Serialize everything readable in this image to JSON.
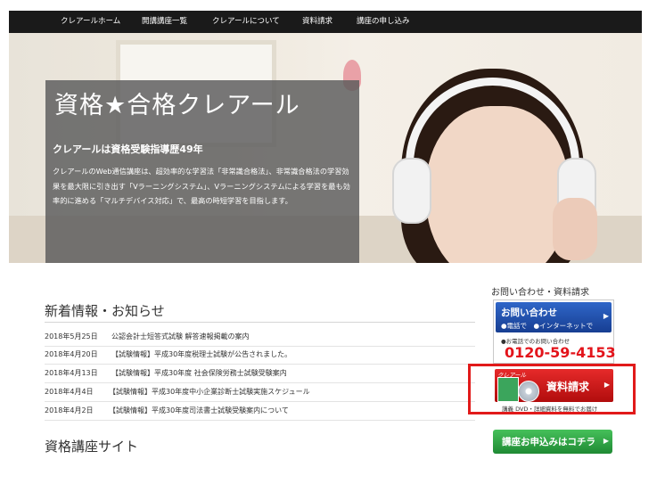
{
  "nav": {
    "items": [
      {
        "label": "クレアールホーム"
      },
      {
        "label": "開講講座一覧"
      },
      {
        "label": "クレアールについて"
      },
      {
        "label": "資料請求"
      },
      {
        "label": "講座の申し込み"
      }
    ]
  },
  "hero": {
    "title": "資格★合格クレアール",
    "subtitle": "クレアールは資格受験指導歴49年",
    "description": "クレアールのWeb通信講座は、超効率的な学習法「非常識合格法」、非常識合格法の学習効果を最大限に引き出す「Vラーニングシステム」、Vラーニングシステムによる学習を最も効率的に進める「マルチデバイス対応」で、最高の時短学習を目指します。"
  },
  "news": {
    "heading": "新着情報・お知らせ",
    "items": [
      {
        "date": "2018年5月25日",
        "text": "公認会計士短答式試験 解答速報掲載の案内"
      },
      {
        "date": "2018年4月20日",
        "text": "【試験情報】平成30年度税理士試験が公告されました。"
      },
      {
        "date": "2018年4月13日",
        "text": "【試験情報】平成30年度 社会保険労務士試験受験案内"
      },
      {
        "date": "2018年4月4日",
        "text": "【試験情報】平成30年度中小企業診断士試験実施スケジュール"
      },
      {
        "date": "2018年4月2日",
        "text": "【試験情報】平成30年度司法書士試験受験案内について"
      }
    ]
  },
  "courses": {
    "heading": "資格講座サイト"
  },
  "sidebar": {
    "heading": "お問い合わせ・資料請求",
    "contact": {
      "title": "お問い合わせ",
      "methods": "●電話で　●インターネットで",
      "phone_note": "●お電話でのお問い合わせ",
      "phone": "0120-59-4153"
    },
    "request": {
      "tag": "クレアール",
      "label": "資料請求",
      "sub": "講義 DVD・詳細資料を無料でお届け"
    },
    "apply": {
      "label": "講座お申込みはコチラ"
    }
  },
  "colors": {
    "nav_bg": "#1a1a1a",
    "contact_blue": "#2f66c8",
    "phone_red": "#e3141b",
    "request_red": "#d41c1c",
    "apply_green": "#2fa345",
    "highlight_border": "#e11a1a"
  },
  "icons": {
    "arrow": "right-arrow-icon",
    "disc": "dvd-disc-icon",
    "book": "brochure-icon"
  }
}
